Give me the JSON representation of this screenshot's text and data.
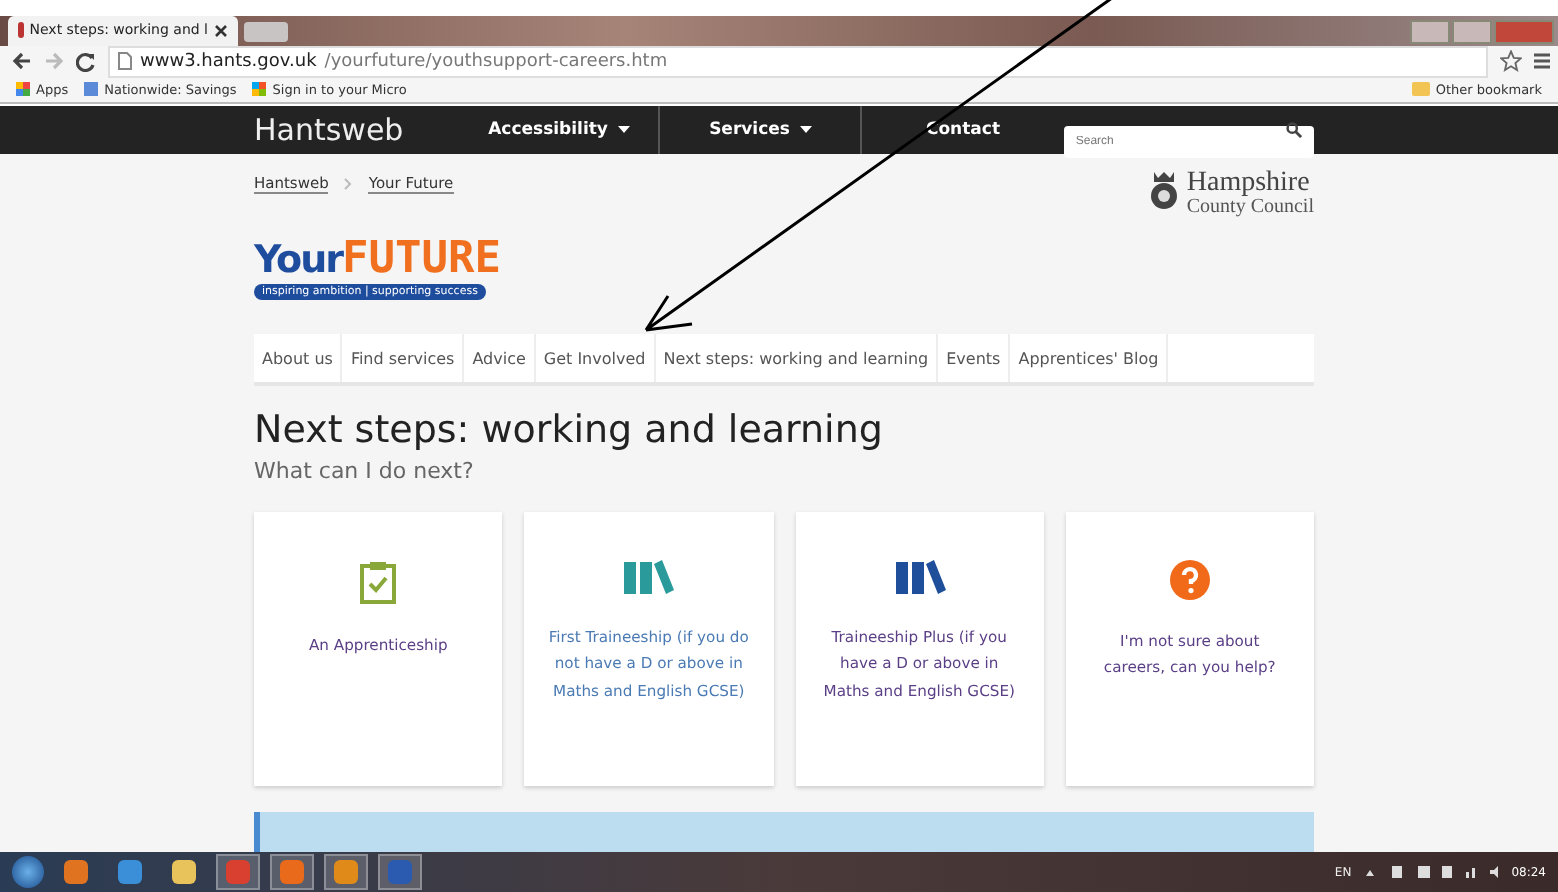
{
  "browser": {
    "tab_title": "Next steps: working and l",
    "url_host": "www3.hants.gov.uk",
    "url_path": "/yourfuture/youthsupport-careers.htm",
    "bookmarks": [
      "Apps",
      "Nationwide: Savings",
      "Sign in to your Micro"
    ],
    "other_bookmarks": "Other bookmark"
  },
  "site_nav": {
    "brand": "Hantsweb",
    "items": [
      {
        "label": "Accessibility",
        "dropdown": true
      },
      {
        "label": "Services",
        "dropdown": true
      },
      {
        "label": "Contact",
        "dropdown": false
      }
    ],
    "search": {
      "placeholder": "Search"
    }
  },
  "breadcrumbs": [
    "Hantsweb",
    "Your Future"
  ],
  "council_logo": {
    "line_1": "Hampshire",
    "line_2": "County Council"
  },
  "site_logo": {
    "part_1": "Your",
    "part_2": "FUTURE",
    "tagline": "inspiring ambition | supporting success"
  },
  "menu": [
    "About us",
    "Find services",
    "Advice",
    "Get Involved",
    "Next steps: working and learning",
    "Events",
    "Apprentices' Blog"
  ],
  "heading": "Next steps: working and learning",
  "subheading": "What can I do next?",
  "cards": [
    {
      "kind": "clipboard",
      "label": "An Apprenticeship",
      "color": "#8aa83a"
    },
    {
      "kind": "books",
      "label": "First Traineeship (if you do not have a D or above in Maths and English GCSE)",
      "color": "#2a9a9a"
    },
    {
      "kind": "books",
      "label": "Traineeship Plus (if you have a D or above in Maths and English GCSE)",
      "color": "#1f4f9a"
    },
    {
      "kind": "question",
      "label": "I'm not sure about careers, can you help?",
      "color": "#f06a1a"
    }
  ],
  "taskbar": {
    "language": "EN",
    "time": "08:24"
  }
}
